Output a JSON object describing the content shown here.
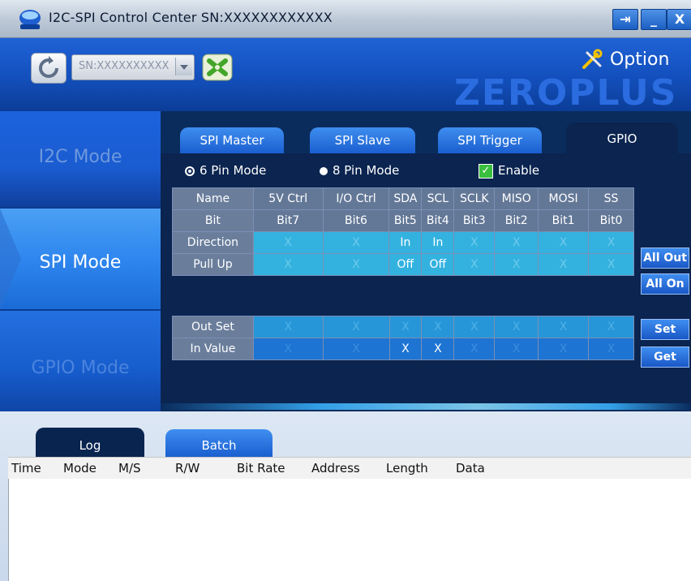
{
  "window": {
    "title": "I2C-SPI Control Center SN:XXXXXXXXXXXX",
    "controls": {
      "pin": "⇥",
      "minimize": "_",
      "close": "X"
    }
  },
  "header": {
    "serial_select_value": "SN:XXXXXXXXXX",
    "option_label": "Option",
    "brand": "ZEROPLUS"
  },
  "nav": {
    "items": [
      {
        "label": "I2C Mode",
        "active": false
      },
      {
        "label": "SPI Mode",
        "active": true
      },
      {
        "label": "GPIO Mode",
        "active": false
      }
    ]
  },
  "tabs": [
    {
      "label": "SPI Master",
      "active": false
    },
    {
      "label": "SPI Slave",
      "active": false
    },
    {
      "label": "SPI Trigger",
      "active": false
    },
    {
      "label": "GPIO",
      "active": true
    }
  ],
  "gpio": {
    "mode_6pin": "6 Pin Mode",
    "mode_8pin": "8 Pin Mode",
    "selected_mode": "6 Pin Mode",
    "enable_label": "Enable",
    "enable_checked": true,
    "names": [
      "Name",
      "5V Ctrl",
      "I/O Ctrl",
      "SDA",
      "SCL",
      "SCLK",
      "MISO",
      "MOSI",
      "SS"
    ],
    "bits": [
      "Bit",
      "Bit7",
      "Bit6",
      "Bit5",
      "Bit4",
      "Bit3",
      "Bit2",
      "Bit1",
      "Bit0"
    ],
    "direction": [
      "Direction",
      "X",
      "X",
      "In",
      "In",
      "X",
      "X",
      "X",
      "X"
    ],
    "pullup": [
      "Pull Up",
      "X",
      "X",
      "Off",
      "Off",
      "X",
      "X",
      "X",
      "X"
    ],
    "outset": [
      "Out Set",
      "X",
      "X",
      "X",
      "X",
      "X",
      "X",
      "X",
      "X"
    ],
    "invalue": [
      "In Value",
      "X",
      "X",
      "X",
      "X",
      "X",
      "X",
      "X",
      "X"
    ],
    "buttons": {
      "all_out": "All Out",
      "all_on": "All On",
      "set": "Set",
      "get": "Get"
    }
  },
  "log": {
    "tabs": [
      {
        "label": "Log",
        "active": true
      },
      {
        "label": "Batch",
        "active": false
      }
    ],
    "columns": [
      "Time",
      "Mode",
      "M/S",
      "R/W",
      "Bit Rate",
      "Address",
      "Length",
      "Data"
    ]
  },
  "colors": {
    "nav_active": "#2f86ee",
    "cell_light": "#33b2e0",
    "cell_dark": "#1d74d2",
    "panel_bg": "#0b2450"
  }
}
